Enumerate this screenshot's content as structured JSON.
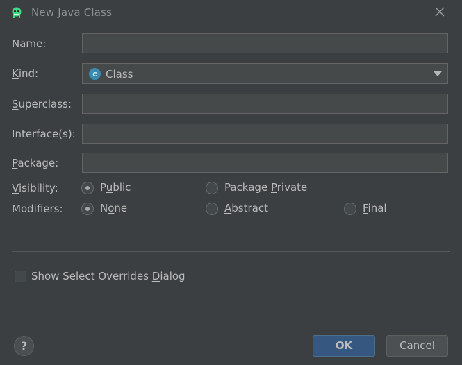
{
  "window": {
    "title": "New Java Class",
    "app_icon": "android-icon",
    "close_icon": "close-icon"
  },
  "form": {
    "name": {
      "label": "Name:",
      "mnemonic": "N",
      "label_rest": "ame:",
      "value": ""
    },
    "kind": {
      "label_pre": "",
      "mnemonic": "K",
      "label_rest": "ind:",
      "selected": "Class",
      "icon_letter": "c",
      "icon_color": "#3a8bb2"
    },
    "superclass": {
      "mnemonic": "S",
      "label_rest": "uperclass:",
      "value": ""
    },
    "interfaces": {
      "mnemonic": "I",
      "label_rest": "nterface(s):",
      "value": ""
    },
    "package": {
      "mnemonic": "P",
      "label_rest": "ackage:",
      "value": ""
    },
    "visibility": {
      "mnemonic": "V",
      "label_rest": "isibility:",
      "options": [
        {
          "pre": "P",
          "mnemonic": "u",
          "post": "blic",
          "checked": true
        },
        {
          "pre": "Package ",
          "mnemonic": "P",
          "post": "rivate",
          "checked": false
        }
      ]
    },
    "modifiers": {
      "mnemonic": "M",
      "label_rest": "odifiers:",
      "options": [
        {
          "pre": "N",
          "mnemonic": "o",
          "post": "ne",
          "checked": true
        },
        {
          "pre": "",
          "mnemonic": "A",
          "post": "bstract",
          "checked": false
        },
        {
          "pre": "",
          "mnemonic": "F",
          "post": "inal",
          "checked": false
        }
      ]
    },
    "overrides": {
      "pre": "Show Select Overrides ",
      "mnemonic": "D",
      "post": "ialog",
      "checked": false
    }
  },
  "footer": {
    "help_label": "?",
    "ok_label": "OK",
    "cancel_label": "Cancel"
  },
  "colors": {
    "background": "#3c3f41",
    "field_bg": "#45494a",
    "accent": "#365880"
  }
}
